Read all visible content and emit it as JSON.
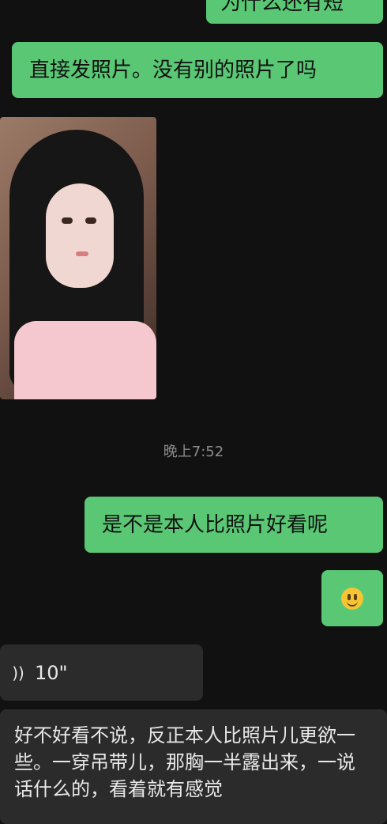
{
  "chat": {
    "messages": [
      {
        "type": "text",
        "side": "right",
        "text": "为什么还有短"
      },
      {
        "type": "text",
        "side": "right",
        "text": "直接发照片。没有别的照片了吗"
      },
      {
        "type": "image",
        "side": "left"
      },
      {
        "type": "timestamp",
        "text": "晚上7:52"
      },
      {
        "type": "text",
        "side": "right",
        "text": "是不是本人比照片好看呢"
      },
      {
        "type": "emoji",
        "side": "right"
      },
      {
        "type": "voice",
        "side": "left",
        "duration": "10\""
      },
      {
        "type": "text",
        "side": "left",
        "text": "好不好看不说，反正本人比照片儿更欲一些。一穿吊带儿，那胸一半露出来，一说话什么的，看着就有感觉"
      }
    ]
  }
}
